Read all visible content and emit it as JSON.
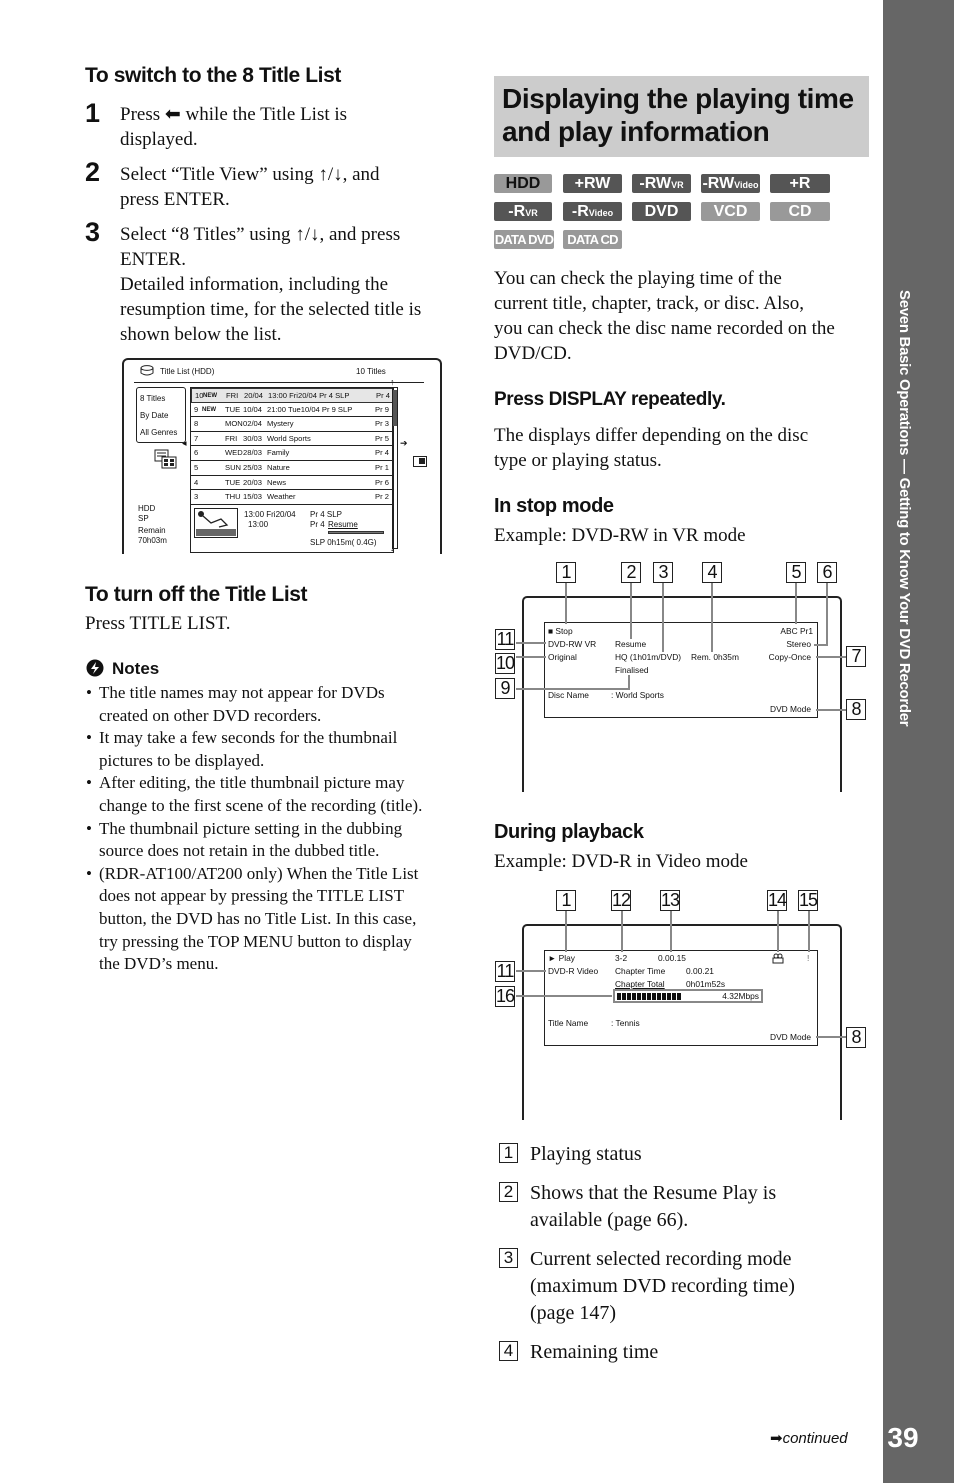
{
  "left": {
    "switch_heading": "To switch to the 8 Title List",
    "steps": [
      {
        "num": "1",
        "lines": [
          "Press ⬅ while the Title List is",
          "displayed."
        ]
      },
      {
        "num": "2",
        "lines": [
          "Select “Title View” using ↑/↓, and",
          "press ENTER."
        ]
      },
      {
        "num": "3",
        "lines": [
          "Select “8 Titles” using ↑/↓, and press",
          "ENTER.",
          "Detailed information, including the",
          "resumption time, for the selected title is",
          "shown below the list."
        ]
      }
    ],
    "title_list_screen": {
      "title": "Title List (HDD)",
      "count": "10 Titles",
      "menu": [
        "8 Titles",
        "By Date",
        "All Genres"
      ],
      "rows": [
        {
          "num": "10",
          "new": "NEW",
          "day": "FRI",
          "date": "20/04",
          "name": "13:00  Fri20/04  Pr 4  SLP",
          "pr": "Pr 4",
          "selected": true
        },
        {
          "num": "9",
          "new": "NEW",
          "day": "TUE",
          "date": "10/04",
          "name": "21:00 Tue10/04  Pr 9  SLP",
          "pr": "Pr 9",
          "selected": false
        },
        {
          "num": "8",
          "new": "",
          "day": "MON",
          "date": "02/04",
          "name": "Mystery",
          "pr": "Pr 3",
          "selected": false
        },
        {
          "num": "7",
          "new": "",
          "day": "FRI",
          "date": "30/03",
          "name": "World Sports",
          "pr": "Pr 5",
          "selected": false
        },
        {
          "num": "6",
          "new": "",
          "day": "WED",
          "date": "28/03",
          "name": "Family",
          "pr": "Pr 4",
          "selected": false
        },
        {
          "num": "5",
          "new": "",
          "day": "SUN",
          "date": "25/03",
          "name": "Nature",
          "pr": "Pr 1",
          "selected": false
        },
        {
          "num": "4",
          "new": "",
          "day": "TUE",
          "date": "20/03",
          "name": "News",
          "pr": "Pr 6",
          "selected": false
        },
        {
          "num": "3",
          "new": "",
          "day": "THU",
          "date": "15/03",
          "name": "Weather",
          "pr": "Pr 2",
          "selected": false
        }
      ],
      "status": [
        "HDD",
        "SP",
        "Remain",
        "70h03m"
      ],
      "detail": {
        "line1": "13:00   Fri20/04",
        "line2": "13:00",
        "pr1": "Pr 4  SLP",
        "pr2": "Pr 4",
        "resume": "Resume",
        "size": "SLP   0h15m( 0.4G)"
      }
    },
    "turn_off_heading": "To turn off the Title List",
    "turn_off_text": "Press TITLE LIST.",
    "notes_heading": "Notes",
    "notes": [
      [
        "The title names may not appear for DVDs",
        "created on other DVD recorders."
      ],
      [
        "It may take a few seconds for the thumbnail",
        "pictures to be displayed."
      ],
      [
        "After editing, the title thumbnail picture may",
        "change to the first scene of the recording (title)."
      ],
      [
        "The thumbnail picture setting in the dubbing",
        "source does not retain in the dubbed title."
      ],
      [
        "(RDR-AT100/AT200 only) When the Title List",
        "does not appear by pressing the TITLE LIST",
        "button, the DVD has no Title List. In this case,",
        "try pressing the TOP MENU button to display",
        "the DVD’s menu."
      ]
    ]
  },
  "right": {
    "section_title": [
      "Displaying the playing time",
      "and play information"
    ],
    "badges": [
      {
        "label": "HDD",
        "sub": "",
        "style": "hdd"
      },
      {
        "label": "+RW",
        "sub": "",
        "style": "dark"
      },
      {
        "label": "-RW",
        "sub": "VR",
        "style": "dark"
      },
      {
        "label": "-RW",
        "sub": "Video",
        "style": "dark"
      },
      {
        "label": "+R",
        "sub": "",
        "style": "dark"
      },
      {
        "label": "-R",
        "sub": "VR",
        "style": "dark"
      },
      {
        "label": "-R",
        "sub": "Video",
        "style": "dark"
      },
      {
        "label": "DVD",
        "sub": "",
        "style": "dark"
      },
      {
        "label": "VCD",
        "sub": "",
        "style": "light"
      },
      {
        "label": "CD",
        "sub": "",
        "style": "light"
      },
      {
        "label": "DATA DVD",
        "sub": "",
        "style": "data"
      },
      {
        "label": "DATA CD",
        "sub": "",
        "style": "data"
      }
    ],
    "intro": [
      "You can check the playing time of the",
      "current title, chapter, track, or disc. Also,",
      "you can check the disc name recorded on the",
      "DVD/CD."
    ],
    "press_heading": "Press DISPLAY repeatedly.",
    "press_text": [
      "The displays differ depending on the disc",
      "type or playing status."
    ],
    "stop_heading": "In stop mode",
    "stop_example": "Example: DVD-RW in VR mode",
    "stop_osd": {
      "status": "■ Stop",
      "disc": "DVD-RW VR",
      "original": "Original",
      "resume": "Resume",
      "mode": "HQ (1h01m/DVD)",
      "finalised": "Finalised",
      "remain": "Rem. 0h35m",
      "channel": "ABC Pr1",
      "audio": "Stereo",
      "copy": "Copy-Once",
      "disc_name_label": "Disc Name",
      "disc_name": ": World Sports",
      "dvd_mode": "DVD Mode",
      "callouts": [
        "1",
        "2",
        "3",
        "4",
        "5",
        "6",
        "7",
        "8",
        "9",
        "10",
        "11"
      ]
    },
    "play_heading": "During playback",
    "play_example": "Example: DVD-R in Video mode",
    "play_osd": {
      "status": "► Play",
      "chapter": "3-2",
      "time": "0.00.15",
      "disc": "DVD-R Video",
      "chapter_time_label": "Chapter Time",
      "chapter_time": "0.00.21",
      "chapter_total_label": "Chapter Total",
      "chapter_total": "0h01m52s",
      "bitrate": "4.32Mbps",
      "bitrate_level": 0.45,
      "title_name_label": "Title Name",
      "title_name": ": Tennis",
      "dvd_mode": "DVD Mode",
      "angle_icon": "camera-angle-icon",
      "mark": "!",
      "callouts": [
        "1",
        "12",
        "13",
        "14",
        "15",
        "11",
        "16",
        "8"
      ]
    },
    "legend": [
      {
        "num": "1",
        "lines": [
          "Playing status"
        ]
      },
      {
        "num": "2",
        "lines": [
          "Shows that the Resume Play is",
          "available (page 66)."
        ]
      },
      {
        "num": "3",
        "lines": [
          "Current selected recording mode",
          "(maximum DVD recording time)",
          "(page 147)"
        ]
      },
      {
        "num": "4",
        "lines": [
          "Remaining time"
        ]
      }
    ]
  },
  "sidebar": {
    "text": "Seven Basic Operations — Getting to Know Your DVD Recorder",
    "page_number": "39",
    "continued": "continued"
  }
}
